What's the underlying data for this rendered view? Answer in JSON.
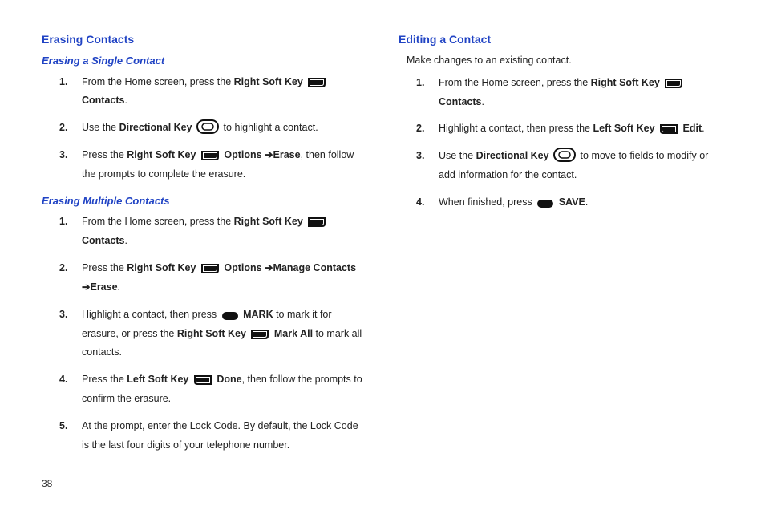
{
  "page_number": "38",
  "left": {
    "heading": "Erasing Contacts",
    "sub1": "Erasing a Single Contact",
    "s1": {
      "t1a": "From the Home screen, press the ",
      "t1b": "Right Soft Key",
      "t1c": "Contacts",
      "t2a": "Use the ",
      "t2b": "Directional Key",
      "t2c": " to highlight a contact.",
      "t3a": "Press the ",
      "t3b": "Right Soft Key",
      "t3c": "Options",
      "t3d": "Erase",
      "t3e": ", then follow the prompts to complete the erasure."
    },
    "sub2": "Erasing Multiple Contacts",
    "s2": {
      "t1a": "From the Home screen, press the ",
      "t1b": "Right Soft Key",
      "t1c": "Contacts",
      "t2a": "Press the ",
      "t2b": "Right Soft Key",
      "t2c": "Options",
      "t2d": "Manage Contacts",
      "t2e": "Erase",
      "t3a": "Highlight a contact, then press ",
      "t3b": "MARK",
      "t3c": " to mark it for erasure, or press the ",
      "t3d": "Right Soft Key",
      "t3e": "Mark All",
      "t3f": " to mark all contacts.",
      "t4a": "Press the ",
      "t4b": "Left Soft Key",
      "t4c": "Done",
      "t4d": ", then follow the prompts to confirm the erasure.",
      "t5": "At the prompt, enter the Lock Code. By default, the Lock Code is the last four digits of your telephone number."
    }
  },
  "right": {
    "heading": "Editing a Contact",
    "intro": "Make changes to an existing contact.",
    "s1": {
      "t1a": "From the Home screen, press the ",
      "t1b": "Right Soft Key",
      "t1c": "Contacts",
      "t2a": "Highlight a contact, then press the ",
      "t2b": "Left Soft Key",
      "t2c": "Edit",
      "t3a": "Use the ",
      "t3b": "Directional Key",
      "t3c": " to move to fields to modify or add information for the contact.",
      "t4a": "When finished, press ",
      "t4b": "SAVE"
    }
  }
}
